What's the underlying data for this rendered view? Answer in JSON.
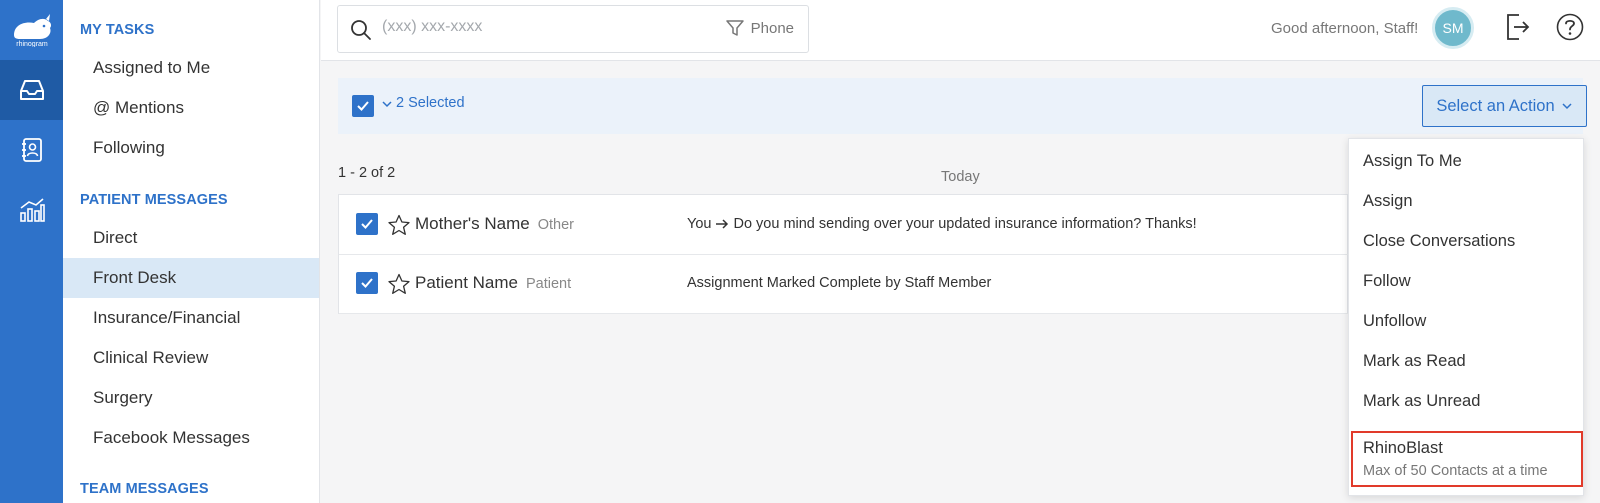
{
  "rail": {
    "logo_text": "rhinogram",
    "items": [
      {
        "icon": "inbox-icon",
        "active": true
      },
      {
        "icon": "contacts-icon",
        "active": false
      },
      {
        "icon": "analytics-icon",
        "active": false
      }
    ]
  },
  "sidebar": {
    "my_tasks_title": "MY TASKS",
    "my_tasks": [
      "Assigned to Me",
      "@ Mentions",
      "Following"
    ],
    "patient_messages_title": "PATIENT MESSAGES",
    "patient_messages": [
      "Direct",
      "Front Desk",
      "Insurance/Financial",
      "Clinical Review",
      "Surgery",
      "Facebook Messages"
    ],
    "selected": "Front Desk",
    "team_messages_title": "TEAM MESSAGES"
  },
  "header": {
    "search_placeholder": "(xxx) xxx-xxxx",
    "search_filter_label": "Phone",
    "greeting": "Good afternoon, Staff!",
    "avatar_initials": "SM"
  },
  "bulk": {
    "selected_label": "2 Selected",
    "action_button_label": "Select an Action"
  },
  "list": {
    "count": "1 - 2 of 2",
    "group_label": "Today",
    "rows": [
      {
        "name": "Mother's Name",
        "type": "Other",
        "prefix": "You",
        "message": "Do you mind sending over your updated insurance information? Thanks!",
        "checked": true
      },
      {
        "name": "Patient Name",
        "type": "Patient",
        "prefix": "",
        "message": "Assignment Marked Complete by Staff Member",
        "checked": true
      }
    ]
  },
  "dropdown": {
    "items": [
      "Assign To Me",
      "Assign",
      "Close Conversations",
      "Follow",
      "Unfollow",
      "Mark as Read",
      "Mark as Unread"
    ],
    "rhinoblast_title": "RhinoBlast",
    "rhinoblast_subtitle": "Max of 50 Contacts at a time"
  },
  "colors": {
    "brand_blue": "#2e72c9",
    "highlight_red": "#e13a2a",
    "selected_bg": "#d9e8f6"
  }
}
